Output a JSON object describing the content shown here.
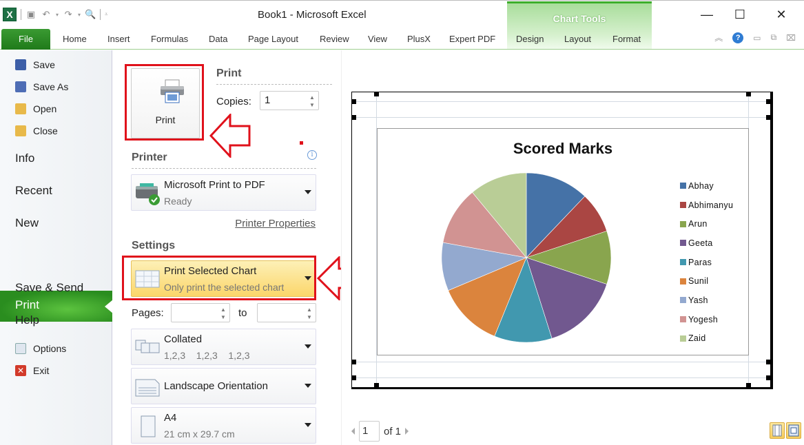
{
  "window": {
    "title": "Book1  -  Microsoft Excel",
    "controls": {
      "minimize": "—",
      "maximize": "☐",
      "close": "✕"
    }
  },
  "quick_access": [
    "save-icon",
    "undo-icon",
    "redo-icon",
    "print-preview-icon",
    "customize-icon"
  ],
  "ribbon": {
    "file_tab": "File",
    "tabs": [
      "Home",
      "Insert",
      "Formulas",
      "Data",
      "Page Layout",
      "Review",
      "View",
      "PlusX",
      "Expert PDF"
    ],
    "contextual_group": "Chart Tools",
    "contextual_tabs": [
      "Design",
      "Layout",
      "Format"
    ],
    "help": "?"
  },
  "nav": {
    "small_top": [
      {
        "label": "Save",
        "icon": "save-icon"
      },
      {
        "label": "Save As",
        "icon": "save-as-icon"
      },
      {
        "label": "Open",
        "icon": "open-folder-icon"
      },
      {
        "label": "Close",
        "icon": "close-folder-icon"
      }
    ],
    "big": [
      "Info",
      "Recent",
      "New",
      "Print",
      "Save & Send",
      "Help"
    ],
    "active": "Print",
    "small_bottom": [
      {
        "label": "Options",
        "icon": "options-icon"
      },
      {
        "label": "Exit",
        "icon": "exit-icon"
      }
    ]
  },
  "print_panel": {
    "print_button": "Print",
    "section_print": "Print",
    "copies_label": "Copies:",
    "copies_value": "1",
    "section_printer": "Printer",
    "printer_name": "Microsoft Print to PDF",
    "printer_status": "Ready",
    "printer_properties": "Printer Properties",
    "section_settings": "Settings",
    "what_title": "Print Selected Chart",
    "what_sub": "Only print the selected chart",
    "pages_label": "Pages:",
    "pages_from": "",
    "to_label": "to",
    "pages_to": "",
    "collate_title": "Collated",
    "collate_sub": "1,2,3    1,2,3    1,2,3",
    "orientation_title": "Landscape Orientation",
    "paper_title": "A4",
    "paper_sub": "21 cm x 29.7 cm"
  },
  "preview": {
    "page_current": "1",
    "page_of": "of 1"
  },
  "chart_data": {
    "type": "pie",
    "title": "Scored Marks",
    "categories": [
      "Abhay",
      "Abhimanyu",
      "Arun",
      "Geeta",
      "Paras",
      "Sunil",
      "Yash",
      "Yogesh",
      "Zaid"
    ],
    "values": [
      87,
      56,
      73,
      108,
      79,
      90,
      66,
      80,
      79
    ],
    "colors": [
      "#4572a7",
      "#aa4643",
      "#89a54e",
      "#71588f",
      "#4198af",
      "#db843d",
      "#93a9cf",
      "#d19392",
      "#b9cd96"
    ],
    "legend": "right",
    "start_angle_deg": 0,
    "direction": "clockwise"
  }
}
